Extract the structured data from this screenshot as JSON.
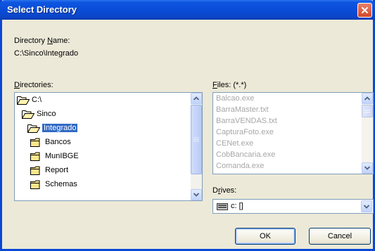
{
  "dialog": {
    "title": "Select Directory",
    "directory_name_label": "Directory ",
    "directory_name_label_u": "N",
    "directory_name_label_rest": "ame:",
    "directory_path": "C:\\Sinco\\Integrado"
  },
  "directories": {
    "label_u": "D",
    "label_rest": "irectories:",
    "items": [
      {
        "label": "C:\\",
        "state": "open"
      },
      {
        "label": "Sinco",
        "state": "open"
      },
      {
        "label": "Integrado",
        "state": "open-selected"
      },
      {
        "label": "Bancos",
        "state": "closed"
      },
      {
        "label": "MunIBGE",
        "state": "closed"
      },
      {
        "label": "Report",
        "state": "closed"
      },
      {
        "label": "Schemas",
        "state": "closed"
      }
    ]
  },
  "files": {
    "label_u": "F",
    "label_rest": "iles: (*.*)",
    "items": [
      "Balcao.exe",
      "BarraMaster.txt",
      "BarraVENDAS.txt",
      "CapturaFoto.exe",
      "CENet.exe",
      "CobBancaria.exe",
      "Comanda.exe"
    ]
  },
  "drives": {
    "label_u": "r",
    "label_pre": "D",
    "label_rest": "ives:",
    "selected": "c: []"
  },
  "buttons": {
    "ok": "OK",
    "cancel": "Cancel"
  },
  "colors": {
    "title_bar": "#0a4bd6",
    "selection": "#316ac5",
    "close_button": "#d4482a"
  }
}
